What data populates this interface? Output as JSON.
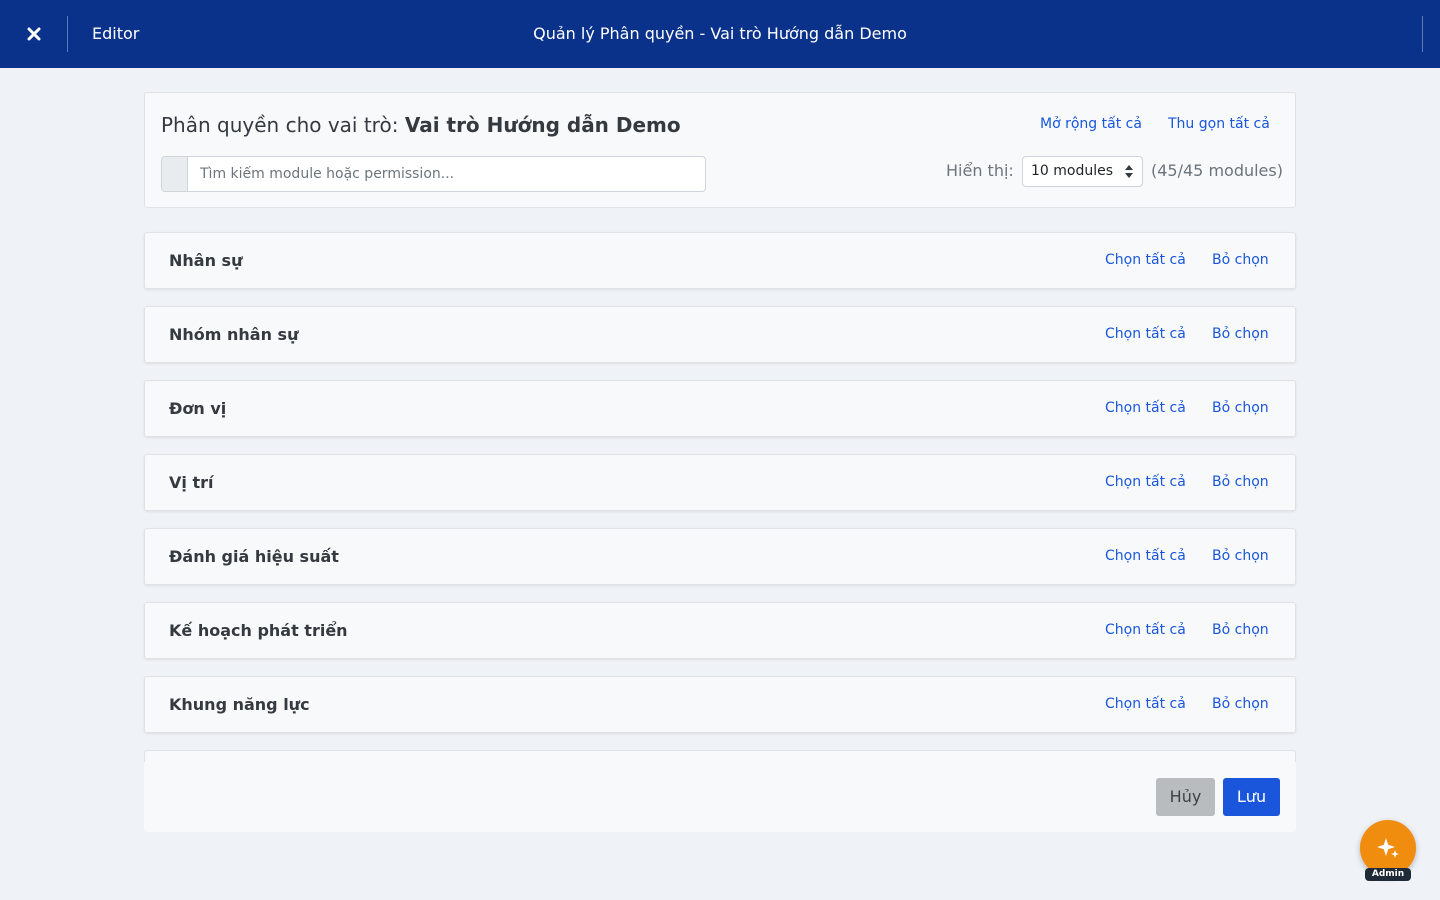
{
  "topbar": {
    "close_icon": "close-x-icon",
    "app_name": "Editor",
    "window_title": "Quản lý Phân quyền - Vai trò Hướng dẫn Demo"
  },
  "header": {
    "heading_prefix": "Phân quyền cho vai trò: ",
    "role_name": "Vai trò Hướng dẫn Demo",
    "expand_all": "Mở rộng tất cả",
    "collapse_all": "Thu gọn tất cả",
    "search_placeholder": "Tìm kiếm module hoặc permission...",
    "search_value": "",
    "display_label": "Hiển thị:",
    "page_size_selected": "10 modules",
    "module_count": "(45/45 modules)"
  },
  "modules": [
    {
      "name": "Nhân sự",
      "select_all": "Chọn tất cả",
      "deselect": "Bỏ chọn"
    },
    {
      "name": "Nhóm nhân sự",
      "select_all": "Chọn tất cả",
      "deselect": "Bỏ chọn"
    },
    {
      "name": "Đơn vị",
      "select_all": "Chọn tất cả",
      "deselect": "Bỏ chọn"
    },
    {
      "name": "Vị trí",
      "select_all": "Chọn tất cả",
      "deselect": "Bỏ chọn"
    },
    {
      "name": "Đánh giá hiệu suất",
      "select_all": "Chọn tất cả",
      "deselect": "Bỏ chọn"
    },
    {
      "name": "Kế hoạch phát triển",
      "select_all": "Chọn tất cả",
      "deselect": "Bỏ chọn"
    },
    {
      "name": "Khung năng lực",
      "select_all": "Chọn tất cả",
      "deselect": "Bỏ chọn"
    }
  ],
  "footer": {
    "cancel_label": "Hủy",
    "save_label": "Lưu"
  },
  "assistant": {
    "icon": "sparkle-icon",
    "badge": "Admin"
  },
  "colors": {
    "topbar_bg": "#0a328a",
    "link": "#1a56db",
    "save_button": "#1a56db",
    "cancel_button": "#b9bcbf",
    "fab": "#f08c0e"
  }
}
